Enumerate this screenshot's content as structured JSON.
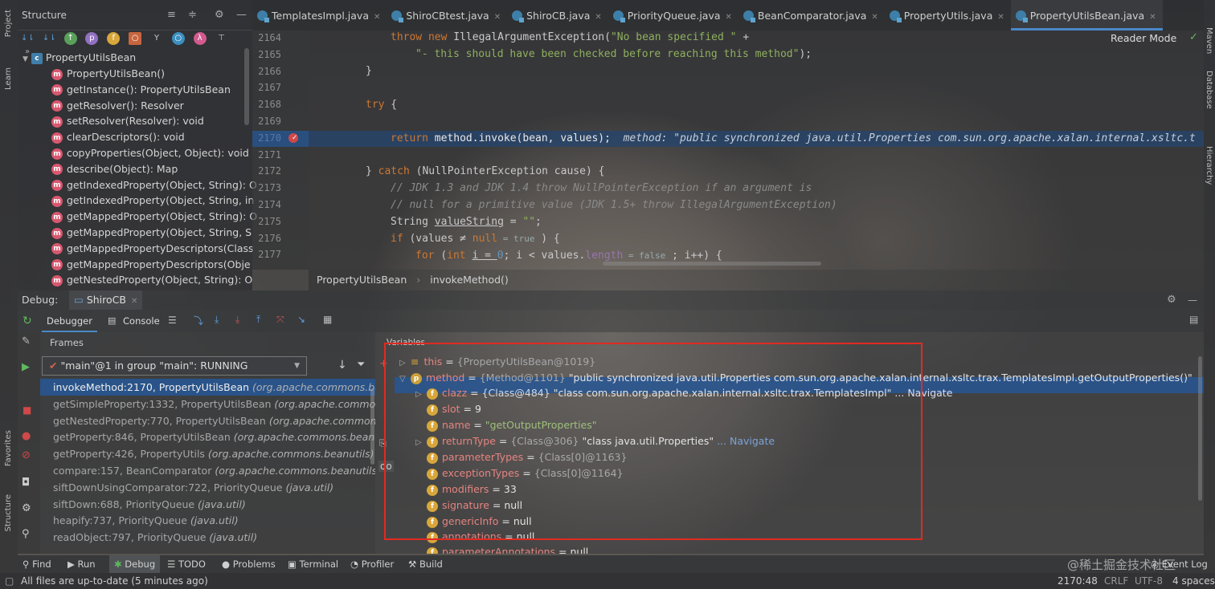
{
  "left_stripe": {
    "project": "Project",
    "learn": "Learn",
    "favorites": "Favorites",
    "structure": "Structure"
  },
  "right_stripe": {
    "maven": "Maven",
    "database": "Database",
    "hierarchy": "Hierarchy"
  },
  "structure": {
    "title": "Structure",
    "root": "PropertyUtilsBean",
    "items": [
      "PropertyUtilsBean()",
      "getInstance(): PropertyUtilsBean",
      "getResolver(): Resolver",
      "setResolver(Resolver): void",
      "clearDescriptors(): void",
      "copyProperties(Object, Object): void",
      "describe(Object): Map",
      "getIndexedProperty(Object, String): O",
      "getIndexedProperty(Object, String, in",
      "getMappedProperty(Object, String): O",
      "getMappedProperty(Object, String, S",
      "getMappedPropertyDescriptors(Class",
      "getMappedPropertyDescriptors(Obje",
      "getNestedProperty(Object, String): O"
    ]
  },
  "tabs": [
    "TemplatesImpl.java",
    "ShiroCBtest.java",
    "ShiroCB.java",
    "PriorityQueue.java",
    "BeanComparator.java",
    "PropertyUtils.java",
    "PropertyUtilsBean.java"
  ],
  "editor": {
    "reader_mode": "Reader Mode",
    "line_numbers": [
      "2164",
      "2165",
      "2166",
      "2167",
      "2168",
      "2169",
      "2170",
      "2171",
      "2172",
      "2173",
      "2174",
      "2175",
      "2176",
      "2177"
    ],
    "lines": {
      "l1a": "throw new ",
      "l1b": "IllegalArgumentException(",
      "l1c": "\"No bean specified \"",
      "l1d": " +",
      "l2": "\"- this should have been checked before reaching this method\"",
      "l2e": ");",
      "l3": "}",
      "l5a": "try",
      "l5b": " {",
      "l7a": "return ",
      "l7b": "method.invoke(bean, values);",
      "l7c": "  method: \"public synchronized java.util.Properties com.sun.org.apache.xalan.internal.xsltc.t",
      "l9a": "} ",
      "l9b": "catch ",
      "l9c": "(NullPointerException cause) {",
      "l10": "// JDK 1.3 and JDK 1.4 throw NullPointerException if an argument is",
      "l11": "// null for a primitive value (JDK 1.5+ throw IllegalArgumentException)",
      "l12a": "String ",
      "l12b": "valueString",
      "l12c": " = ",
      "l12d": "\"\"",
      "l12e": ";",
      "l13a": "if ",
      "l13b": "(values ",
      "l13c": "≠ ",
      "l13d": "null",
      "l13e": " = true",
      "l13f": " ) {",
      "l14a": "for ",
      "l14b": "(",
      "l14c": "int ",
      "l14d": "i = ",
      "l14e": "0",
      "l14f": "; i < values.",
      "l14g": "length",
      "l14h": " = false",
      "l14i": " ; i++) {"
    }
  },
  "breadcrumb": [
    "PropertyUtilsBean",
    "invokeMethod()"
  ],
  "debug": {
    "label": "Debug:",
    "session": "ShiroCB",
    "tab_debugger": "Debugger",
    "tab_console": "Console",
    "frames_label": "Frames",
    "variables_label": "Variables",
    "thread": "\"main\"@1 in group \"main\": RUNNING",
    "frames": [
      {
        "m": "invokeMethod:2170, PropertyUtilsBean",
        "p": "(org.apache.commons.beanu"
      },
      {
        "m": "getSimpleProperty:1332, PropertyUtilsBean",
        "p": "(org.apache.commons.be"
      },
      {
        "m": "getNestedProperty:770, PropertyUtilsBean",
        "p": "(org.apache.commons.be"
      },
      {
        "m": "getProperty:846, PropertyUtilsBean",
        "p": "(org.apache.commons.beanutils)"
      },
      {
        "m": "getProperty:426, PropertyUtils",
        "p": "(org.apache.commons.beanutils)"
      },
      {
        "m": "compare:157, BeanComparator",
        "p": "(org.apache.commons.beanutils)"
      },
      {
        "m": "siftDownUsingComparator:722, PriorityQueue",
        "p": "(java.util)"
      },
      {
        "m": "siftDown:688, PriorityQueue",
        "p": "(java.util)"
      },
      {
        "m": "heapify:737, PriorityQueue",
        "p": "(java.util)"
      },
      {
        "m": "readObject:797, PriorityQueue",
        "p": "(java.util)"
      }
    ],
    "vars": {
      "this_n": "this",
      "this_v": "{PropertyUtilsBean@1019}",
      "method_n": "method",
      "method_r": "{Method@1101}",
      "method_v": "\"public synchronized java.util.Properties com.sun.org.apache.xalan.internal.xsltc.trax.TemplatesImpl.getOutputProperties()\"",
      "clazz_n": "clazz",
      "clazz_r": "{Class@484}",
      "clazz_v": "\"class com.sun.org.apache.xalan.internal.xsltc.trax.TemplatesImpl\"",
      "clazz_nav": "... Navigate",
      "slot_n": "slot",
      "slot_v": "9",
      "name_n": "name",
      "name_v": "\"getOutputProperties\"",
      "rt_n": "returnType",
      "rt_r": "{Class@306}",
      "rt_v": "\"class java.util.Properties\"",
      "rt_nav": "... Navigate",
      "pt_n": "parameterTypes",
      "pt_v": "{Class[0]@1163}",
      "et_n": "exceptionTypes",
      "et_v": "{Class[0]@1164}",
      "mod_n": "modifiers",
      "mod_v": "33",
      "sig_n": "signature",
      "sig_v": "null",
      "gi_n": "genericInfo",
      "gi_v": "null",
      "ann_n": "annotations",
      "ann_v": "null",
      "pa_n": "parameterAnnotations",
      "pa_v": "null"
    },
    "eq": " = "
  },
  "bottom_tabs": [
    "Find",
    "Run",
    "Debug",
    "TODO",
    "Problems",
    "Terminal",
    "Profiler",
    "Build"
  ],
  "event_log": "Event Log",
  "status": {
    "message": "All files are up-to-date (5 minutes ago)",
    "position": "2170:48",
    "crlf": "CRLF",
    "encoding": "UTF-8",
    "indent": "4 spaces"
  },
  "watermark": "@稀土掘金技术社区"
}
